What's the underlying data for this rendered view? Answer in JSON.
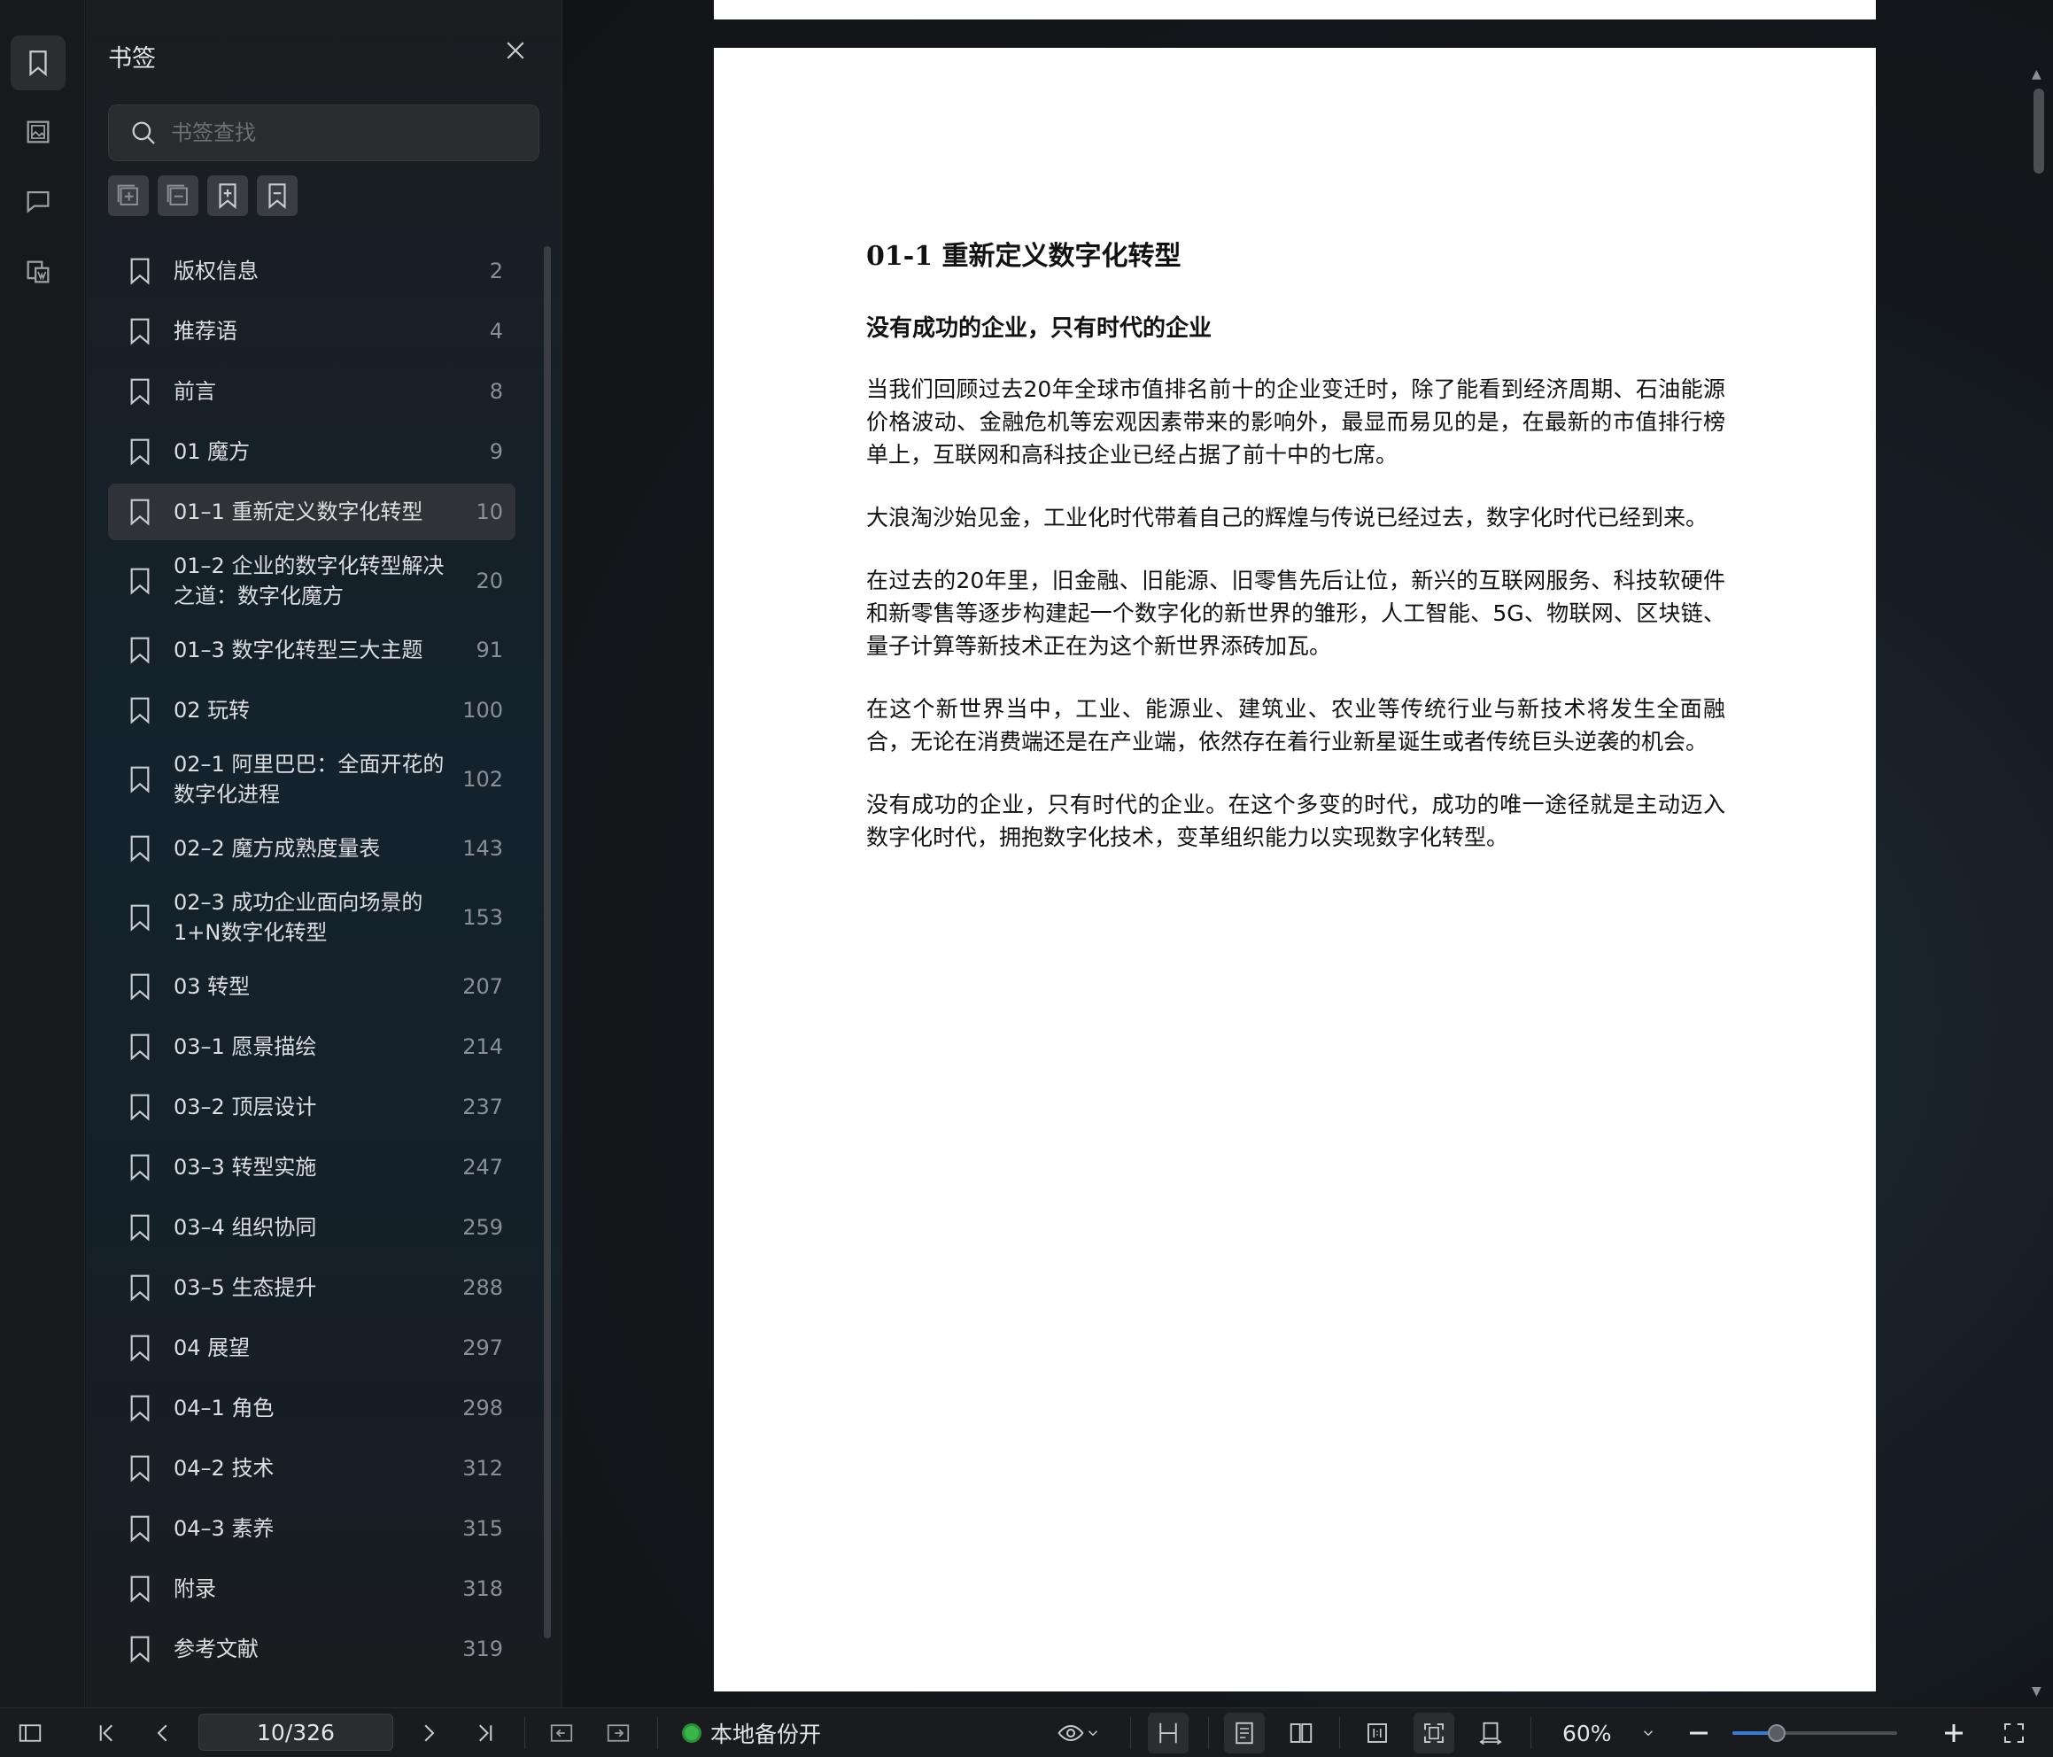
{
  "panel": {
    "title": "书签",
    "search_placeholder": "书签查找"
  },
  "bookmarks": [
    {
      "label": "版权信息",
      "page": "2"
    },
    {
      "label": "推荐语",
      "page": "4"
    },
    {
      "label": "前言",
      "page": "8"
    },
    {
      "label": "01 魔方",
      "page": "9"
    },
    {
      "label": "01–1 重新定义数字化转型",
      "page": "10",
      "active": true
    },
    {
      "label": "01–2 企业的数字化转型解决之道：数字化魔方",
      "page": "20"
    },
    {
      "label": "01–3 数字化转型三大主题",
      "page": "91"
    },
    {
      "label": "02 玩转",
      "page": "100"
    },
    {
      "label": "02–1 阿里巴巴：全面开花的数字化进程",
      "page": "102"
    },
    {
      "label": "02–2 魔方成熟度量表",
      "page": "143"
    },
    {
      "label": "02–3 成功企业面向场景的1+N数字化转型",
      "page": "153"
    },
    {
      "label": "03 转型",
      "page": "207"
    },
    {
      "label": "03–1 愿景描绘",
      "page": "214"
    },
    {
      "label": "03–2 顶层设计",
      "page": "237"
    },
    {
      "label": "03–3 转型实施",
      "page": "247"
    },
    {
      "label": "03–4 组织协同",
      "page": "259"
    },
    {
      "label": "03–5 生态提升",
      "page": "288"
    },
    {
      "label": "04 展望",
      "page": "297"
    },
    {
      "label": "04–1 角色",
      "page": "298"
    },
    {
      "label": "04–2 技术",
      "page": "312"
    },
    {
      "label": "04–3 素养",
      "page": "315"
    },
    {
      "label": "附录",
      "page": "318"
    },
    {
      "label": "参考文献",
      "page": "319"
    }
  ],
  "document": {
    "heading": "01-1 重新定义数字化转型",
    "subheading": "没有成功的企业，只有时代的企业",
    "paragraphs": [
      "当我们回顾过去20年全球市值排名前十的企业变迁时，除了能看到经济周期、石油能源价格波动、金融危机等宏观因素带来的影响外，最显而易见的是，在最新的市值排行榜单上，互联网和高科技企业已经占据了前十中的七席。",
      "大浪淘沙始见金，工业化时代带着自己的辉煌与传说已经过去，数字化时代已经到来。",
      "在过去的20年里，旧金融、旧能源、旧零售先后让位，新兴的互联网服务、科技软硬件和新零售等逐步构建起一个数字化的新世界的雏形，人工智能、5G、物联网、区块链、量子计算等新技术正在为这个新世界添砖加瓦。",
      "在这个新世界当中，工业、能源业、建筑业、农业等传统行业与新技术将发生全面融合，无论在消费端还是在产业端，依然存在着行业新星诞生或者传统巨头逆袭的机会。",
      "没有成功的企业，只有时代的企业。在这个多变的时代，成功的唯一途径就是主动迈入数字化时代，拥抱数字化技术，变革组织能力以实现数字化转型。"
    ]
  },
  "statusbar": {
    "page_indicator": "10/326",
    "backup_status": "本地备份开",
    "zoom": "60%",
    "zoom_fraction": 0.27
  },
  "colors": {
    "accent": "#3a7bd5",
    "backup_dot": "#39b54a"
  }
}
